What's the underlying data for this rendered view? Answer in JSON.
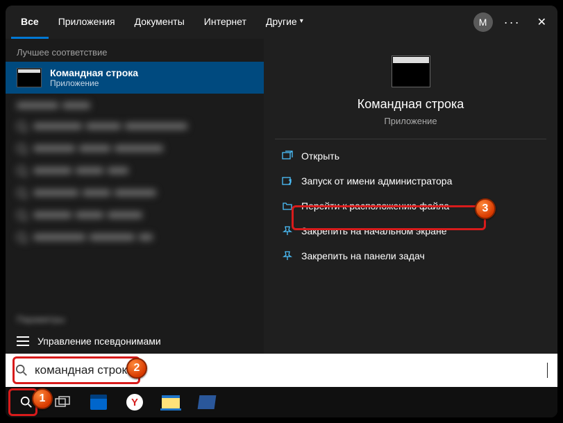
{
  "tabs": {
    "items": [
      "Все",
      "Приложения",
      "Документы",
      "Интернет",
      "Другие"
    ],
    "active_index": 0
  },
  "avatar_initial": "М",
  "left": {
    "section_header": "Лучшее соответствие",
    "best_match": {
      "title": "Командная строка",
      "subtitle": "Приложение"
    },
    "params_header": "Параметры",
    "settings_row": "Управление псевдонимами"
  },
  "right": {
    "title": "Командная строка",
    "subtitle": "Приложение",
    "actions": [
      {
        "label": "Открыть",
        "icon": "open-icon"
      },
      {
        "label": "Запуск от имени администратора",
        "icon": "admin-icon"
      },
      {
        "label": "Перейти к расположению файла",
        "icon": "folder-icon"
      },
      {
        "label": "Закрепить на начальном экране",
        "icon": "pin-start-icon"
      },
      {
        "label": "Закрепить на панели задач",
        "icon": "pin-taskbar-icon"
      }
    ]
  },
  "search": {
    "value": "командная строка"
  },
  "badges": {
    "b1": "1",
    "b2": "2",
    "b3": "3"
  }
}
